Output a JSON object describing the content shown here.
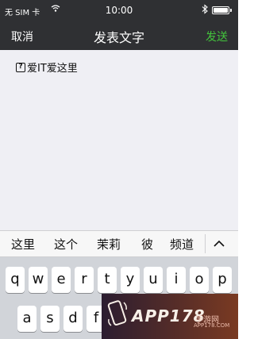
{
  "status_bar": {
    "carrier": "无 SIM 卡",
    "time": "10:00"
  },
  "nav": {
    "cancel_label": "取消",
    "title": "发表文字",
    "send_label": "发送"
  },
  "compose": {
    "icon": "question-box-icon",
    "text": "爱IT爱这里"
  },
  "candidates": [
    "这里",
    "这个",
    "茉莉",
    "彼",
    "频道"
  ],
  "keyboard": {
    "row1": [
      "q",
      "w",
      "e",
      "r",
      "t",
      "y",
      "u",
      "i",
      "o",
      "p"
    ],
    "row2": [
      "a",
      "s",
      "d",
      "f"
    ]
  },
  "watermark": {
    "brand": "APP178",
    "sub": "手游网",
    "url": "APP178.COM"
  },
  "colors": {
    "bar": "#2f3033",
    "send": "#43c43c",
    "compose_bg": "#efeff4",
    "keyboard_bg": "#d1d4d9"
  }
}
